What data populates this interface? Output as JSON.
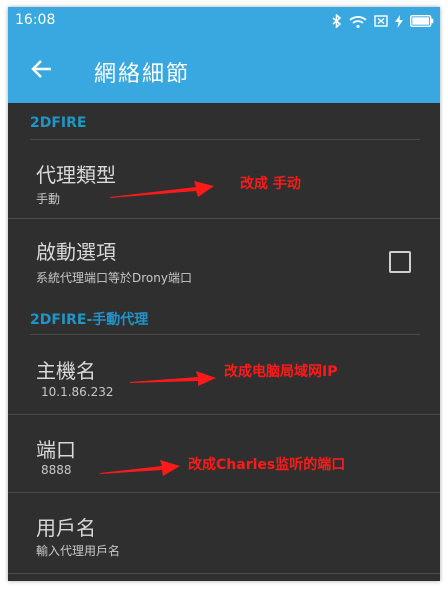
{
  "status": {
    "time": "16:08",
    "icons": [
      "bluetooth-icon",
      "wifi-icon",
      "sim-off-icon",
      "charging-icon",
      "battery-icon"
    ]
  },
  "appbar": {
    "back_icon": "arrow-back-icon",
    "title": "網絡細節"
  },
  "sections": {
    "s1": "2DFIRE",
    "s2": "2DFIRE-手動代理"
  },
  "rows": {
    "proxy_type": {
      "title": "代理類型",
      "value": "手動"
    },
    "startup": {
      "title": "啟動選項",
      "value": "系統代理端口等於Drony端口",
      "checked": false
    },
    "hostname": {
      "title": "主機名",
      "value": "10.1.86.232"
    },
    "port": {
      "title": "端口",
      "value": "8888"
    },
    "username": {
      "title": "用戶名",
      "value": "輸入代理用戶名"
    }
  },
  "annotations": {
    "a1": "改成 手动",
    "a2": "改成电脑局域网IP",
    "a3": "改成Charles监听的端口"
  },
  "colors": {
    "accent": "#3aa8e0",
    "section": "#1f95c8",
    "background": "#2f2f2f",
    "annotation": "#ff1a1a"
  }
}
